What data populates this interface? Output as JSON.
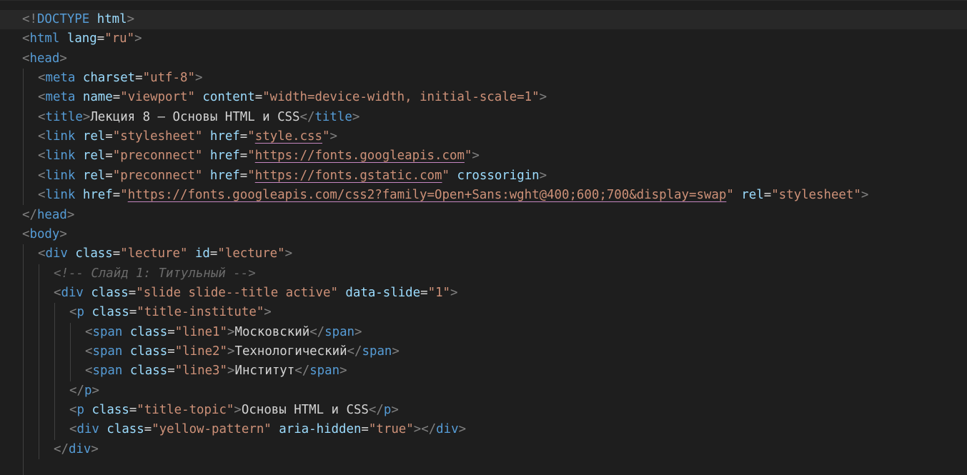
{
  "editor": {
    "language": "html",
    "lines": [
      {
        "indent": 0,
        "tokens": [
          {
            "t": "punc",
            "v": "<!"
          },
          {
            "t": "tag",
            "v": "DOCTYPE"
          },
          {
            "t": "txt",
            "v": " "
          },
          {
            "t": "attr",
            "v": "html"
          },
          {
            "t": "punc",
            "v": ">"
          }
        ]
      },
      {
        "indent": 0,
        "tokens": [
          {
            "t": "punc",
            "v": "<"
          },
          {
            "t": "tag",
            "v": "html"
          },
          {
            "t": "txt",
            "v": " "
          },
          {
            "t": "attr",
            "v": "lang"
          },
          {
            "t": "txt",
            "v": "="
          },
          {
            "t": "str",
            "v": "\"ru\""
          },
          {
            "t": "punc",
            "v": ">"
          }
        ]
      },
      {
        "indent": 0,
        "tokens": [
          {
            "t": "punc",
            "v": "<"
          },
          {
            "t": "tag",
            "v": "head"
          },
          {
            "t": "punc",
            "v": ">"
          }
        ]
      },
      {
        "indent": 1,
        "tokens": [
          {
            "t": "punc",
            "v": "<"
          },
          {
            "t": "tag",
            "v": "meta"
          },
          {
            "t": "txt",
            "v": " "
          },
          {
            "t": "attr",
            "v": "charset"
          },
          {
            "t": "txt",
            "v": "="
          },
          {
            "t": "str",
            "v": "\"utf-8\""
          },
          {
            "t": "punc",
            "v": ">"
          }
        ]
      },
      {
        "indent": 1,
        "tokens": [
          {
            "t": "punc",
            "v": "<"
          },
          {
            "t": "tag",
            "v": "meta"
          },
          {
            "t": "txt",
            "v": " "
          },
          {
            "t": "attr",
            "v": "name"
          },
          {
            "t": "txt",
            "v": "="
          },
          {
            "t": "str",
            "v": "\"viewport\""
          },
          {
            "t": "txt",
            "v": " "
          },
          {
            "t": "attr",
            "v": "content"
          },
          {
            "t": "txt",
            "v": "="
          },
          {
            "t": "str",
            "v": "\"width=device-width, initial-scale=1\""
          },
          {
            "t": "punc",
            "v": ">"
          }
        ]
      },
      {
        "indent": 1,
        "tokens": [
          {
            "t": "punc",
            "v": "<"
          },
          {
            "t": "tag",
            "v": "title"
          },
          {
            "t": "punc",
            "v": ">"
          },
          {
            "t": "txt",
            "v": "Лекция 8 — Основы HTML и CSS"
          },
          {
            "t": "punc",
            "v": "</"
          },
          {
            "t": "tag",
            "v": "title"
          },
          {
            "t": "punc",
            "v": ">"
          }
        ]
      },
      {
        "indent": 1,
        "tokens": [
          {
            "t": "punc",
            "v": "<"
          },
          {
            "t": "tag",
            "v": "link"
          },
          {
            "t": "txt",
            "v": " "
          },
          {
            "t": "attr",
            "v": "rel"
          },
          {
            "t": "txt",
            "v": "="
          },
          {
            "t": "str",
            "v": "\"stylesheet\""
          },
          {
            "t": "txt",
            "v": " "
          },
          {
            "t": "attr",
            "v": "href"
          },
          {
            "t": "txt",
            "v": "="
          },
          {
            "t": "str",
            "v": "\""
          },
          {
            "t": "str-link",
            "v": "style.css"
          },
          {
            "t": "str",
            "v": "\""
          },
          {
            "t": "punc",
            "v": ">"
          }
        ]
      },
      {
        "indent": 1,
        "tokens": [
          {
            "t": "punc",
            "v": "<"
          },
          {
            "t": "tag",
            "v": "link"
          },
          {
            "t": "txt",
            "v": " "
          },
          {
            "t": "attr",
            "v": "rel"
          },
          {
            "t": "txt",
            "v": "="
          },
          {
            "t": "str",
            "v": "\"preconnect\""
          },
          {
            "t": "txt",
            "v": " "
          },
          {
            "t": "attr",
            "v": "href"
          },
          {
            "t": "txt",
            "v": "="
          },
          {
            "t": "str",
            "v": "\""
          },
          {
            "t": "str-link",
            "v": "https://fonts.googleapis.com"
          },
          {
            "t": "str",
            "v": "\""
          },
          {
            "t": "punc",
            "v": ">"
          }
        ]
      },
      {
        "indent": 1,
        "tokens": [
          {
            "t": "punc",
            "v": "<"
          },
          {
            "t": "tag",
            "v": "link"
          },
          {
            "t": "txt",
            "v": " "
          },
          {
            "t": "attr",
            "v": "rel"
          },
          {
            "t": "txt",
            "v": "="
          },
          {
            "t": "str",
            "v": "\"preconnect\""
          },
          {
            "t": "txt",
            "v": " "
          },
          {
            "t": "attr",
            "v": "href"
          },
          {
            "t": "txt",
            "v": "="
          },
          {
            "t": "str",
            "v": "\""
          },
          {
            "t": "str-link",
            "v": "https://fonts.gstatic.com"
          },
          {
            "t": "str",
            "v": "\""
          },
          {
            "t": "txt",
            "v": " "
          },
          {
            "t": "attr",
            "v": "crossorigin"
          },
          {
            "t": "punc",
            "v": ">"
          }
        ]
      },
      {
        "indent": 1,
        "tokens": [
          {
            "t": "punc",
            "v": "<"
          },
          {
            "t": "tag",
            "v": "link"
          },
          {
            "t": "txt",
            "v": " "
          },
          {
            "t": "attr",
            "v": "href"
          },
          {
            "t": "txt",
            "v": "="
          },
          {
            "t": "str",
            "v": "\""
          },
          {
            "t": "str-link",
            "v": "https://fonts.googleapis.com/css2?family=Open+Sans:wght@400;600;700&display=swap"
          },
          {
            "t": "str",
            "v": "\""
          },
          {
            "t": "txt",
            "v": " "
          },
          {
            "t": "attr",
            "v": "rel"
          },
          {
            "t": "txt",
            "v": "="
          },
          {
            "t": "str",
            "v": "\"stylesheet\""
          },
          {
            "t": "punc",
            "v": ">"
          }
        ]
      },
      {
        "indent": 0,
        "tokens": [
          {
            "t": "punc",
            "v": "</"
          },
          {
            "t": "tag",
            "v": "head"
          },
          {
            "t": "punc",
            "v": ">"
          }
        ]
      },
      {
        "indent": 0,
        "tokens": [
          {
            "t": "punc",
            "v": "<"
          },
          {
            "t": "tag",
            "v": "body"
          },
          {
            "t": "punc",
            "v": ">"
          }
        ]
      },
      {
        "indent": 1,
        "tokens": [
          {
            "t": "punc",
            "v": "<"
          },
          {
            "t": "tag",
            "v": "div"
          },
          {
            "t": "txt",
            "v": " "
          },
          {
            "t": "attr",
            "v": "class"
          },
          {
            "t": "txt",
            "v": "="
          },
          {
            "t": "str",
            "v": "\"lecture\""
          },
          {
            "t": "txt",
            "v": " "
          },
          {
            "t": "attr",
            "v": "id"
          },
          {
            "t": "txt",
            "v": "="
          },
          {
            "t": "str",
            "v": "\"lecture\""
          },
          {
            "t": "punc",
            "v": ">"
          }
        ]
      },
      {
        "indent": 2,
        "tokens": [
          {
            "t": "cmt-dim",
            "v": "<!-- Слайд 1: Титульный -->"
          }
        ]
      },
      {
        "indent": 2,
        "tokens": [
          {
            "t": "punc",
            "v": "<"
          },
          {
            "t": "tag",
            "v": "div"
          },
          {
            "t": "txt",
            "v": " "
          },
          {
            "t": "attr",
            "v": "class"
          },
          {
            "t": "txt",
            "v": "="
          },
          {
            "t": "str",
            "v": "\"slide slide--title active\""
          },
          {
            "t": "txt",
            "v": " "
          },
          {
            "t": "attr",
            "v": "data-slide"
          },
          {
            "t": "txt",
            "v": "="
          },
          {
            "t": "str",
            "v": "\"1\""
          },
          {
            "t": "punc",
            "v": ">"
          }
        ]
      },
      {
        "indent": 3,
        "tokens": [
          {
            "t": "punc",
            "v": "<"
          },
          {
            "t": "tag",
            "v": "p"
          },
          {
            "t": "txt",
            "v": " "
          },
          {
            "t": "attr",
            "v": "class"
          },
          {
            "t": "txt",
            "v": "="
          },
          {
            "t": "str",
            "v": "\"title-institute\""
          },
          {
            "t": "punc",
            "v": ">"
          }
        ]
      },
      {
        "indent": 4,
        "tokens": [
          {
            "t": "punc",
            "v": "<"
          },
          {
            "t": "tag",
            "v": "span"
          },
          {
            "t": "txt",
            "v": " "
          },
          {
            "t": "attr",
            "v": "class"
          },
          {
            "t": "txt",
            "v": "="
          },
          {
            "t": "str",
            "v": "\"line1\""
          },
          {
            "t": "punc",
            "v": ">"
          },
          {
            "t": "txt",
            "v": "Московский"
          },
          {
            "t": "punc",
            "v": "</"
          },
          {
            "t": "tag",
            "v": "span"
          },
          {
            "t": "punc",
            "v": ">"
          }
        ]
      },
      {
        "indent": 4,
        "tokens": [
          {
            "t": "punc",
            "v": "<"
          },
          {
            "t": "tag",
            "v": "span"
          },
          {
            "t": "txt",
            "v": " "
          },
          {
            "t": "attr",
            "v": "class"
          },
          {
            "t": "txt",
            "v": "="
          },
          {
            "t": "str",
            "v": "\"line2\""
          },
          {
            "t": "punc",
            "v": ">"
          },
          {
            "t": "txt",
            "v": "Технологический"
          },
          {
            "t": "punc",
            "v": "</"
          },
          {
            "t": "tag",
            "v": "span"
          },
          {
            "t": "punc",
            "v": ">"
          }
        ]
      },
      {
        "indent": 4,
        "tokens": [
          {
            "t": "punc",
            "v": "<"
          },
          {
            "t": "tag",
            "v": "span"
          },
          {
            "t": "txt",
            "v": " "
          },
          {
            "t": "attr",
            "v": "class"
          },
          {
            "t": "txt",
            "v": "="
          },
          {
            "t": "str",
            "v": "\"line3\""
          },
          {
            "t": "punc",
            "v": ">"
          },
          {
            "t": "txt",
            "v": "Институт"
          },
          {
            "t": "punc",
            "v": "</"
          },
          {
            "t": "tag",
            "v": "span"
          },
          {
            "t": "punc",
            "v": ">"
          }
        ]
      },
      {
        "indent": 3,
        "tokens": [
          {
            "t": "punc",
            "v": "</"
          },
          {
            "t": "tag",
            "v": "p"
          },
          {
            "t": "punc",
            "v": ">"
          }
        ]
      },
      {
        "indent": 3,
        "tokens": [
          {
            "t": "punc",
            "v": "<"
          },
          {
            "t": "tag",
            "v": "p"
          },
          {
            "t": "txt",
            "v": " "
          },
          {
            "t": "attr",
            "v": "class"
          },
          {
            "t": "txt",
            "v": "="
          },
          {
            "t": "str",
            "v": "\"title-topic\""
          },
          {
            "t": "punc",
            "v": ">"
          },
          {
            "t": "txt",
            "v": "Основы HTML и CSS"
          },
          {
            "t": "punc",
            "v": "</"
          },
          {
            "t": "tag",
            "v": "p"
          },
          {
            "t": "punc",
            "v": ">"
          }
        ]
      },
      {
        "indent": 3,
        "tokens": [
          {
            "t": "punc",
            "v": "<"
          },
          {
            "t": "tag",
            "v": "div"
          },
          {
            "t": "txt",
            "v": " "
          },
          {
            "t": "attr",
            "v": "class"
          },
          {
            "t": "txt",
            "v": "="
          },
          {
            "t": "str",
            "v": "\"yellow-pattern\""
          },
          {
            "t": "txt",
            "v": " "
          },
          {
            "t": "attr",
            "v": "aria-hidden"
          },
          {
            "t": "txt",
            "v": "="
          },
          {
            "t": "str",
            "v": "\"true\""
          },
          {
            "t": "punc",
            "v": ">"
          },
          {
            "t": "punc",
            "v": "</"
          },
          {
            "t": "tag",
            "v": "div"
          },
          {
            "t": "punc",
            "v": ">"
          }
        ]
      },
      {
        "indent": 2,
        "tokens": [
          {
            "t": "punc",
            "v": "</"
          },
          {
            "t": "tag",
            "v": "div"
          },
          {
            "t": "punc",
            "v": ">"
          }
        ]
      }
    ],
    "current_line": 0
  },
  "colors": {
    "background": "#1e1e1e",
    "current_line": "#282828",
    "tag": "#569cd6",
    "attribute": "#9cdcfe",
    "string": "#ce9178",
    "punctuation": "#808080",
    "text": "#d4d4d4",
    "comment": "#6b6b6b",
    "link_underline": "#c586c0",
    "indent_guide": "#404040"
  }
}
